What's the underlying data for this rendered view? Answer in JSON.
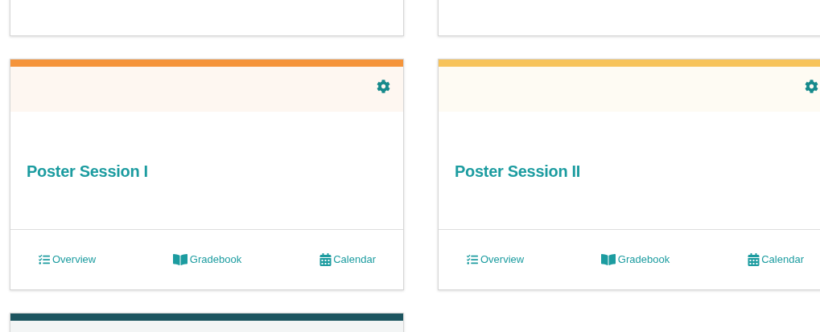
{
  "cards": [
    {
      "kind": "cut-bottom"
    },
    {
      "kind": "cut-bottom"
    },
    {
      "kind": "full",
      "color": "#f5943a",
      "title": "Poster Session I",
      "links": [
        {
          "kind": "overview",
          "label": "Overview"
        },
        {
          "kind": "gradebook",
          "label": "Gradebook"
        },
        {
          "kind": "calendar",
          "label": "Calendar"
        }
      ]
    },
    {
      "kind": "full",
      "color": "#f7c35a",
      "title": "Poster Session II",
      "links": [
        {
          "kind": "overview",
          "label": "Overview"
        },
        {
          "kind": "gradebook",
          "label": "Gradebook"
        },
        {
          "kind": "calendar",
          "label": "Calendar"
        }
      ]
    },
    {
      "kind": "cut-top",
      "color": "#1d5560"
    }
  ]
}
